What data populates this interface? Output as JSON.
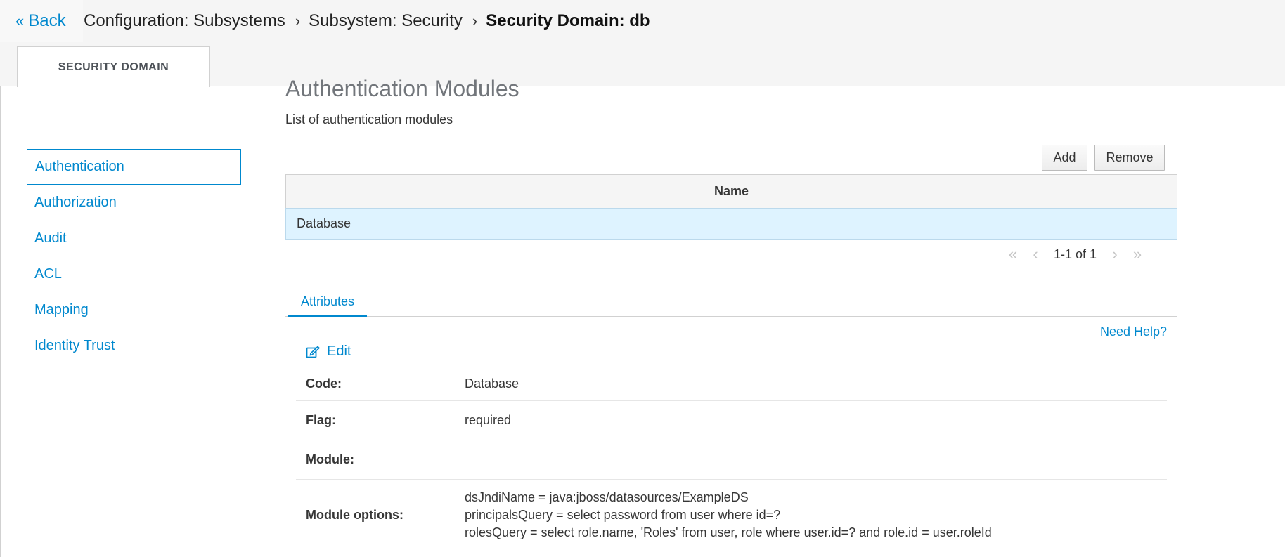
{
  "header": {
    "back_label": "Back",
    "breadcrumb": [
      "Configuration: Subsystems",
      "Subsystem: Security",
      "Security Domain: db"
    ],
    "tab": "SECURITY DOMAIN"
  },
  "sidebar": {
    "items": [
      {
        "label": "Authentication",
        "active": true
      },
      {
        "label": "Authorization"
      },
      {
        "label": "Audit"
      },
      {
        "label": "ACL"
      },
      {
        "label": "Mapping"
      },
      {
        "label": "Identity Trust"
      }
    ]
  },
  "main": {
    "title": "Authentication Modules",
    "description": "List of authentication modules",
    "buttons": {
      "add": "Add",
      "remove": "Remove"
    },
    "table": {
      "columns": [
        "Name"
      ],
      "rows": [
        [
          "Database"
        ]
      ]
    },
    "pager": {
      "text": "1-1 of 1"
    },
    "tabs": [
      "Attributes"
    ],
    "need_help": "Need Help?",
    "edit_label": "Edit",
    "attributes": [
      {
        "label": "Code:",
        "value": "Database"
      },
      {
        "label": "Flag:",
        "value": "required"
      },
      {
        "label": "Module:",
        "value": ""
      },
      {
        "label": "Module options:",
        "lines": [
          "dsJndiName = java:jboss/datasources/ExampleDS",
          "principalsQuery = select password from user where id=?",
          "rolesQuery = select role.name, 'Roles' from user, role where user.id=? and role.id = user.roleId"
        ]
      }
    ]
  },
  "colors": {
    "accent": "#0088ce",
    "selected_row": "#def3ff"
  }
}
